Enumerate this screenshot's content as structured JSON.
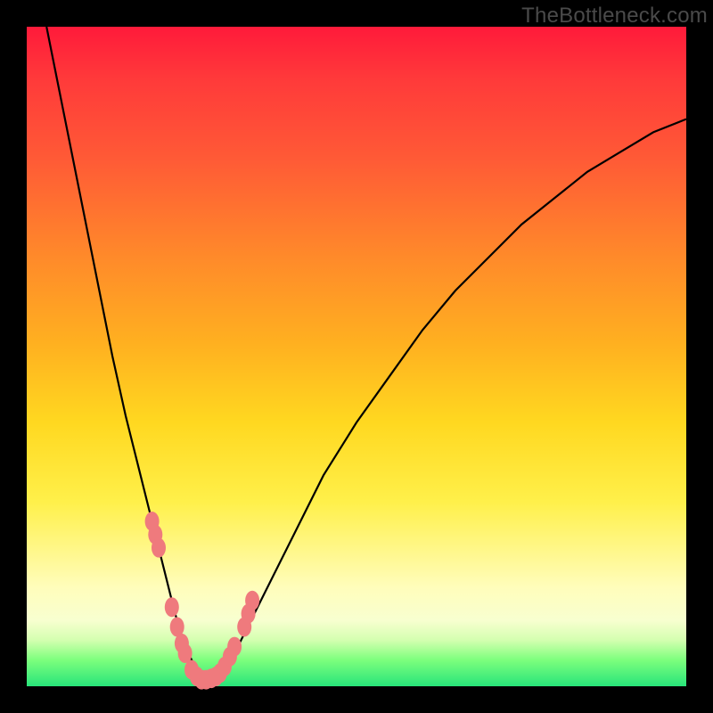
{
  "watermark": {
    "text": "TheBottleneck.com"
  },
  "chart_data": {
    "type": "line",
    "title": "",
    "xlabel": "",
    "ylabel": "",
    "xlim": [
      0,
      100
    ],
    "ylim": [
      0,
      100
    ],
    "series": [
      {
        "name": "curve",
        "x": [
          3,
          5,
          7,
          9,
          11,
          13,
          15,
          17,
          19,
          21,
          22.5,
          24,
          25.5,
          27,
          29,
          32,
          35,
          40,
          45,
          50,
          55,
          60,
          65,
          70,
          75,
          80,
          85,
          90,
          95,
          100
        ],
        "values": [
          100,
          90,
          80,
          70,
          60,
          50,
          41,
          33,
          25,
          17,
          11,
          6,
          3,
          1,
          1,
          6,
          12,
          22,
          32,
          40,
          47,
          54,
          60,
          65,
          70,
          74,
          78,
          81,
          84,
          86
        ]
      },
      {
        "name": "markers",
        "x": [
          19.0,
          19.5,
          20.0,
          22.0,
          22.8,
          23.5,
          24.0,
          25.0,
          25.8,
          26.5,
          27.2,
          28.0,
          28.7,
          29.3,
          30.0,
          30.8,
          31.5,
          33.0,
          33.6,
          34.2
        ],
        "values": [
          25,
          23,
          21,
          12,
          9,
          6.5,
          5,
          2.5,
          1.5,
          1,
          1,
          1.2,
          1.5,
          2,
          3,
          4.5,
          6,
          9,
          11,
          13
        ]
      }
    ],
    "marker_color": "#ef7a7d",
    "curve_color": "#000000"
  }
}
